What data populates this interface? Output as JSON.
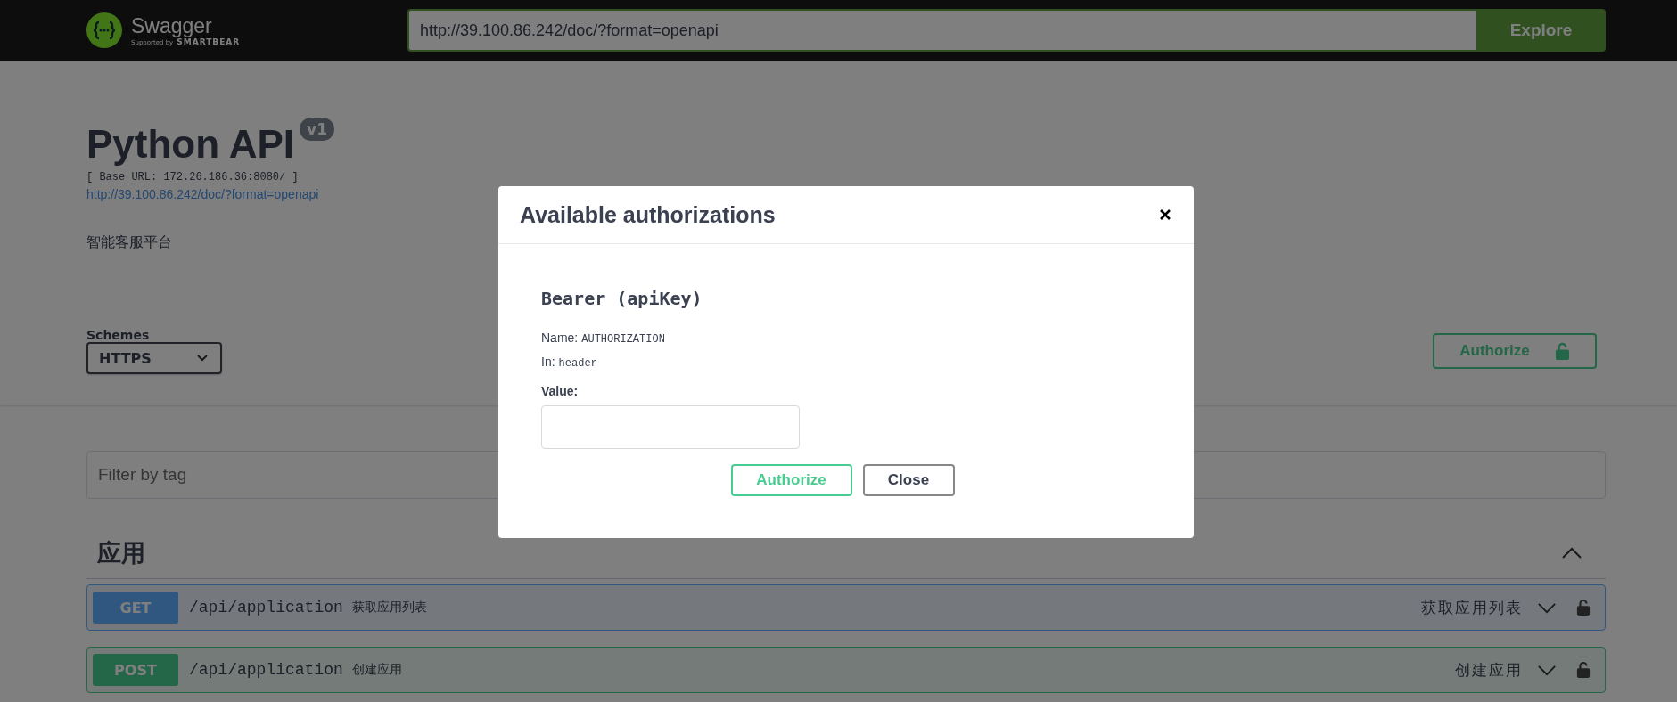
{
  "header": {
    "logo_text": "Swagger",
    "logo_subtext": "Supported by",
    "logo_brand": "SMARTBEAR",
    "url": "http://39.100.86.242/doc/?format=openapi",
    "explore_button": "Explore"
  },
  "info": {
    "title": "Python API",
    "version": "v1",
    "base_url": "[ Base URL: 172.26.186.36:8080/ ]",
    "spec_link": "http://39.100.86.242/doc/?format=openapi",
    "description": "智能客服平台"
  },
  "schemes": {
    "label": "Schemes",
    "value": "HTTPS"
  },
  "authorize_button": "Authorize",
  "filter": {
    "placeholder": "Filter by tag"
  },
  "tags": [
    {
      "name": "应用",
      "expanded": true,
      "operations": [
        {
          "method": "GET",
          "path": "/api/application",
          "summary": "获取应用列表",
          "summary_right": "获取应用列表",
          "expanded": false
        },
        {
          "method": "POST",
          "path": "/api/application",
          "summary": "创建应用",
          "summary_right": "创建应用",
          "expanded": false
        }
      ]
    }
  ],
  "modal": {
    "title": "Available authorizations",
    "scheme_title": "Bearer  (apiKey)",
    "name_label": "Name:",
    "name_value": "AUTHORIZATION",
    "in_label": "In:",
    "in_value": "header",
    "value_label": "Value:",
    "buttons": [
      {
        "label": "Authorize",
        "kind": "primary"
      },
      {
        "label": "Close",
        "kind": "secondary"
      }
    ]
  }
}
